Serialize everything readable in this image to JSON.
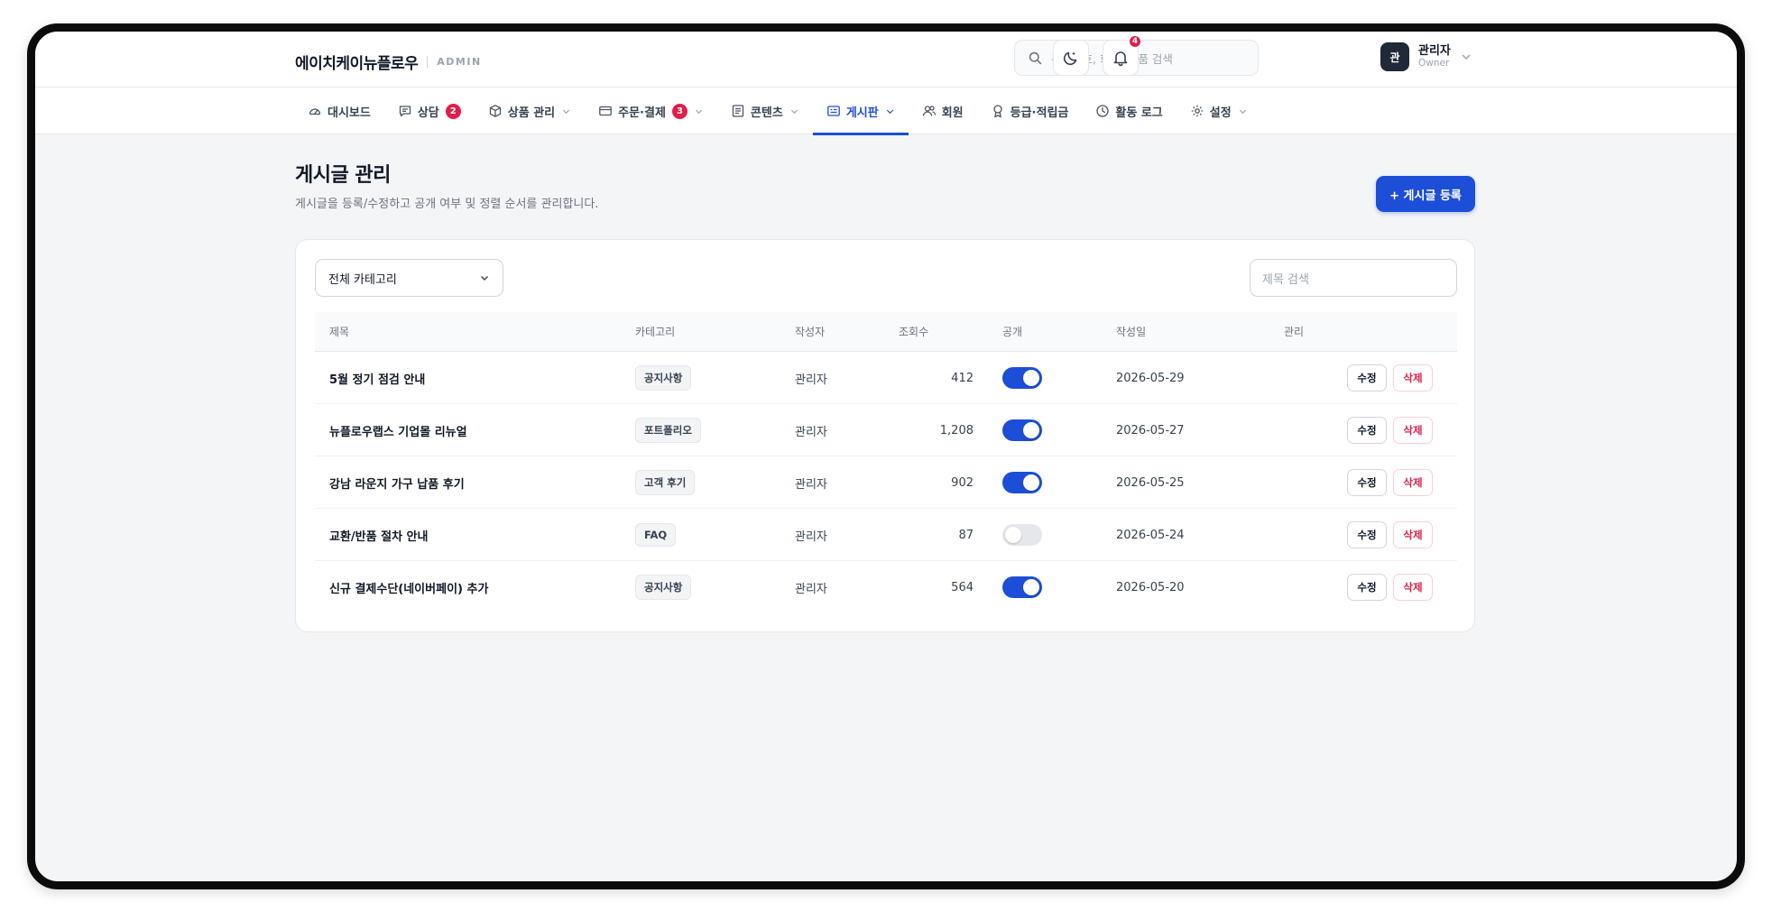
{
  "header": {
    "brand_name": "에이치케이뉴플로우",
    "brand_tag": "ADMIN",
    "search_placeholder": "주문번호, 회원, 상품 검색",
    "notification_count": "4",
    "user": {
      "avatar": "관",
      "name": "관리자",
      "role": "Owner"
    }
  },
  "nav": {
    "items": [
      {
        "label": "대시보드",
        "icon": "gauge-icon"
      },
      {
        "label": "상담",
        "icon": "message-icon",
        "badge": "2"
      },
      {
        "label": "상품 관리",
        "icon": "box-icon"
      },
      {
        "label": "주문·결제",
        "icon": "card-icon",
        "badge": "3"
      },
      {
        "label": "콘텐츠",
        "icon": "document-icon"
      },
      {
        "label": "게시판",
        "icon": "board-icon",
        "active": true
      },
      {
        "label": "회원",
        "icon": "users-icon"
      },
      {
        "label": "등급·적립금",
        "icon": "award-icon"
      },
      {
        "label": "활동 로그",
        "icon": "clock-icon"
      },
      {
        "label": "설정",
        "icon": "gear-icon"
      }
    ]
  },
  "page": {
    "title": "게시글 관리",
    "subtitle": "게시글을 등록/수정하고 공개 여부 및 정렬 순서를 관리합니다.",
    "add_button": "+ 게시글 등록"
  },
  "filters": {
    "category_selected": "전체 카테고리",
    "title_search_placeholder": "제목 검색"
  },
  "table": {
    "columns": [
      "제목",
      "카테고리",
      "작성자",
      "조회수",
      "공개",
      "작성일",
      "관리"
    ],
    "edit_label": "수정",
    "delete_label": "삭제",
    "rows": [
      {
        "title": "5월 정기 점검 안내",
        "category": "공지사항",
        "author": "관리자",
        "views": "412",
        "public": true,
        "date": "2026-05-29"
      },
      {
        "title": "뉴플로우랩스 기업몰 리뉴얼",
        "category": "포트폴리오",
        "author": "관리자",
        "views": "1,208",
        "public": true,
        "date": "2026-05-27"
      },
      {
        "title": "강남 라운지 가구 납품 후기",
        "category": "고객 후기",
        "author": "관리자",
        "views": "902",
        "public": true,
        "date": "2026-05-25"
      },
      {
        "title": "교환/반품 절차 안내",
        "category": "FAQ",
        "author": "관리자",
        "views": "87",
        "public": false,
        "date": "2026-05-24"
      },
      {
        "title": "신규 결제수단(네이버페이) 추가",
        "category": "공지사항",
        "author": "관리자",
        "views": "564",
        "public": true,
        "date": "2026-05-20"
      }
    ]
  },
  "colors": {
    "accent": "#1d4ed8",
    "danger": "#e11d48",
    "background": "#f4f5f7"
  }
}
